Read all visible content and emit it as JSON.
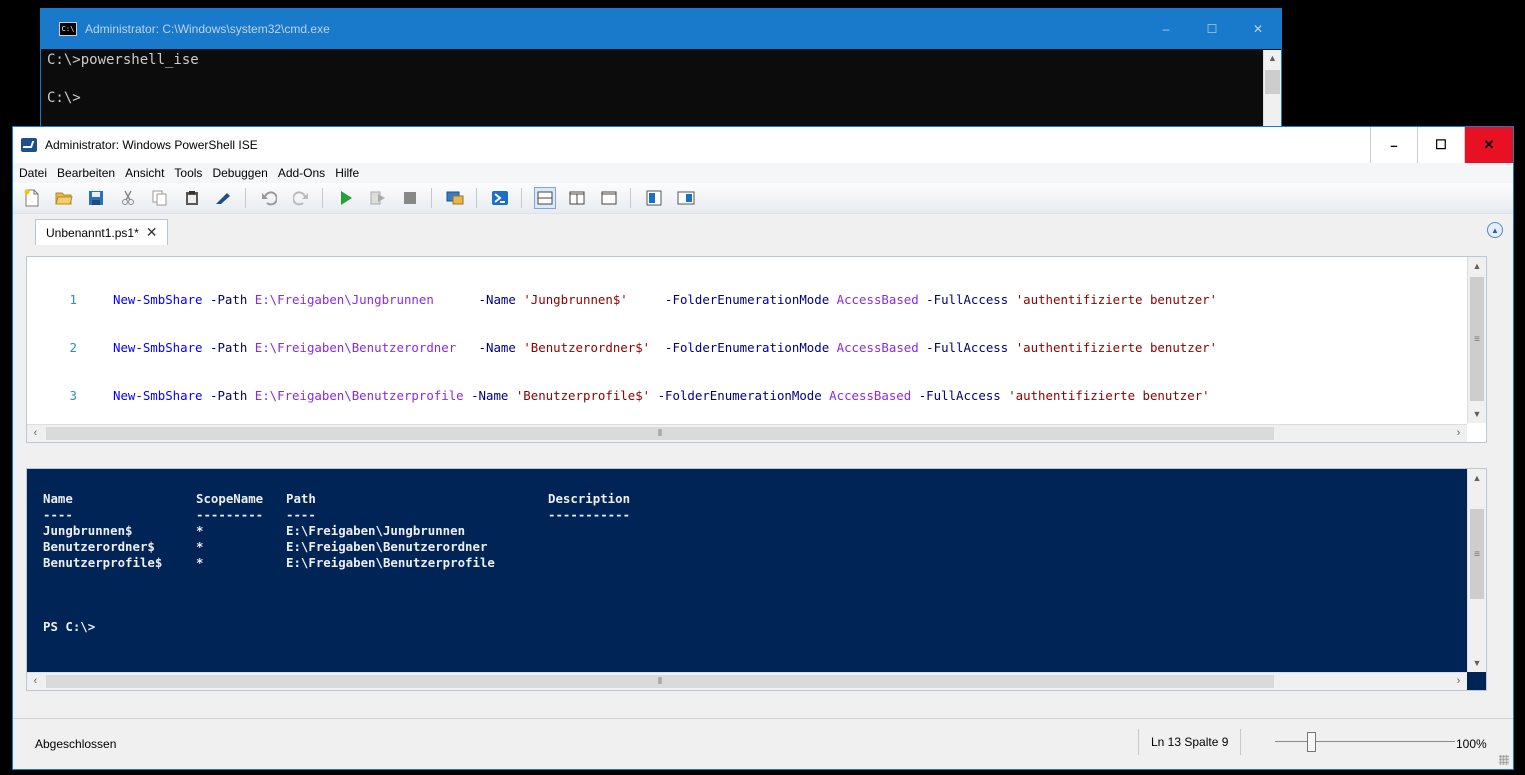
{
  "cmd": {
    "title": "Administrator: C:\\Windows\\system32\\cmd.exe",
    "icon_text": "C:\\",
    "lines": [
      "C:\\>powershell_ise",
      "",
      "C:\\>"
    ],
    "minimize": "–",
    "maximize": "☐",
    "close": "✕"
  },
  "ise": {
    "title": "Administrator: Windows PowerShell ISE",
    "minimize": "–",
    "maximize": "☐",
    "close": "✕",
    "menu": [
      "Datei",
      "Bearbeiten",
      "Ansicht",
      "Tools",
      "Debuggen",
      "Add-Ons",
      "Hilfe"
    ],
    "toolbar_icons": [
      "new-script-icon",
      "open-icon",
      "save-icon",
      "cut-icon",
      "copy-icon",
      "paste-icon",
      "clear-icon",
      "undo-icon",
      "redo-icon",
      "run-icon",
      "run-selection-icon",
      "stop-icon",
      "remote-powershell-icon",
      "powershell-console-icon",
      "layout-top-icon",
      "layout-right-icon",
      "layout-max-icon",
      "show-commands-icon",
      "show-addon-icon"
    ],
    "tab": {
      "label": "Unbenannt1.ps1*",
      "close": "✕"
    },
    "code": [
      {
        "num": "1",
        "cmd": "New-SmbShare",
        "p1": " -Path ",
        "path": "E:\\Freigaben\\Jungbrunnen     ",
        "p2": " -Name ",
        "name": "'Jungbrunnen$'    ",
        "p3": " -FolderEnumerationMode ",
        "mode": "AccessBased",
        "p4": " -FullAccess ",
        "access": "'authentifizierte benutzer'"
      },
      {
        "num": "2",
        "cmd": "New-SmbShare",
        "p1": " -Path ",
        "path": "E:\\Freigaben\\Benutzerordner  ",
        "p2": " -Name ",
        "name": "'Benutzerordner$' ",
        "p3": " -FolderEnumerationMode ",
        "mode": "AccessBased",
        "p4": " -FullAccess ",
        "access": "'authentifizierte benutzer'"
      },
      {
        "num": "3",
        "cmd": "New-SmbShare",
        "p1": " -Path ",
        "path": "E:\\Freigaben\\Benutzerprofile",
        "p2": " -Name ",
        "name": "'Benutzerprofile$'",
        "p3": " -FolderEnumerationMode ",
        "mode": "AccessBased",
        "p4": " -FullAccess ",
        "access": "'authentifizierte benutzer'"
      }
    ],
    "console": {
      "headers": {
        "name": "Name",
        "scope": "ScopeName",
        "path": "Path",
        "desc": "Description"
      },
      "underline": {
        "name": "----",
        "scope": "---------",
        "path": "----",
        "desc": "-----------"
      },
      "rows": [
        {
          "name": "Jungbrunnen$",
          "scope": "*",
          "path": "E:\\Freigaben\\Jungbrunnen"
        },
        {
          "name": "Benutzerordner$",
          "scope": "*",
          "path": "E:\\Freigaben\\Benutzerordner"
        },
        {
          "name": "Benutzerprofile$",
          "scope": "*",
          "path": "E:\\Freigaben\\Benutzerprofile"
        }
      ],
      "prompt": "PS C:\\>"
    },
    "status": {
      "text": "Abgeschlossen",
      "position": "Ln 13  Spalte 9",
      "zoom": "100%",
      "zoom_level_fraction": 0.2
    }
  }
}
